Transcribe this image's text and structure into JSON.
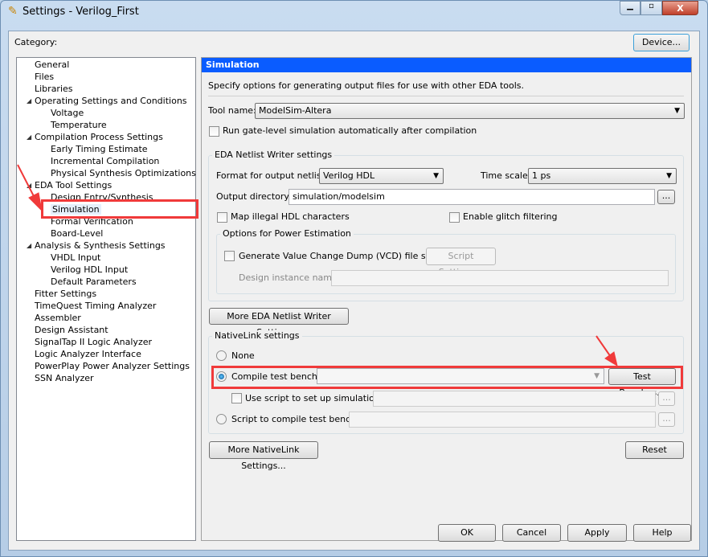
{
  "window": {
    "title": "Settings - Verilog_First",
    "minimize": "minimize",
    "maximize": "maximize",
    "close": "X"
  },
  "category_label": "Category:",
  "device_button": "Device...",
  "tree": [
    {
      "label": "General",
      "level": 0
    },
    {
      "label": "Files",
      "level": 0
    },
    {
      "label": "Libraries",
      "level": 0
    },
    {
      "label": "Operating Settings and Conditions",
      "level": 0,
      "expanded": true
    },
    {
      "label": "Voltage",
      "level": 1
    },
    {
      "label": "Temperature",
      "level": 1
    },
    {
      "label": "Compilation Process Settings",
      "level": 0,
      "expanded": true
    },
    {
      "label": "Early Timing Estimate",
      "level": 1
    },
    {
      "label": "Incremental Compilation",
      "level": 1
    },
    {
      "label": "Physical Synthesis Optimizations",
      "level": 1
    },
    {
      "label": "EDA Tool Settings",
      "level": 0,
      "expanded": true
    },
    {
      "label": "Design Entry/Synthesis",
      "level": 1
    },
    {
      "label": "Simulation",
      "level": 1,
      "selected": true
    },
    {
      "label": "Formal Verification",
      "level": 1
    },
    {
      "label": "Board-Level",
      "level": 1
    },
    {
      "label": "Analysis & Synthesis Settings",
      "level": 0,
      "expanded": true
    },
    {
      "label": "VHDL Input",
      "level": 1
    },
    {
      "label": "Verilog HDL Input",
      "level": 1
    },
    {
      "label": "Default Parameters",
      "level": 1
    },
    {
      "label": "Fitter Settings",
      "level": 0
    },
    {
      "label": "TimeQuest Timing Analyzer",
      "level": 0
    },
    {
      "label": "Assembler",
      "level": 0
    },
    {
      "label": "Design Assistant",
      "level": 0
    },
    {
      "label": "SignalTap II Logic Analyzer",
      "level": 0
    },
    {
      "label": "Logic Analyzer Interface",
      "level": 0
    },
    {
      "label": "PowerPlay Power Analyzer Settings",
      "level": 0
    },
    {
      "label": "SSN Analyzer",
      "level": 0
    }
  ],
  "panel": {
    "header": "Simulation",
    "description": "Specify options for generating output files for use with other EDA tools.",
    "tool_name_label": "Tool name:",
    "tool_name": "ModelSim-Altera",
    "run_gate_level": "Run gate-level simulation automatically after compilation",
    "eda": {
      "title": "EDA Netlist Writer settings",
      "format_label": "Format for output netlist:",
      "format": "Verilog HDL",
      "timescale_label": "Time scale:",
      "timescale": "1 ps",
      "outdir_label": "Output directory:",
      "outdir": "simulation/modelsim",
      "browse": "...",
      "map_illegal": "Map illegal HDL characters",
      "glitch": "Enable glitch filtering",
      "power": {
        "title": "Options for Power Estimation",
        "vcd": "Generate Value Change Dump (VCD) file script",
        "script_settings": "Script Settings...",
        "instance_label": "Design instance name:",
        "instance": ""
      }
    },
    "more_eda": "More EDA Netlist Writer Settings...",
    "nativelink": {
      "title": "NativeLink settings",
      "none": "None",
      "compile": "Compile test bench:",
      "compile_value": "",
      "test_benches": "Test Benches...",
      "use_script": "Use script to set up simulation:",
      "script_compile": "Script to compile test bench:",
      "browse": "..."
    },
    "more_nativelink": "More NativeLink Settings...",
    "reset": "Reset"
  },
  "footer": {
    "ok": "OK",
    "cancel": "Cancel",
    "apply": "Apply",
    "help": "Help"
  },
  "colors": {
    "header": "#0a5cff",
    "annotation": "#f03a3a"
  }
}
